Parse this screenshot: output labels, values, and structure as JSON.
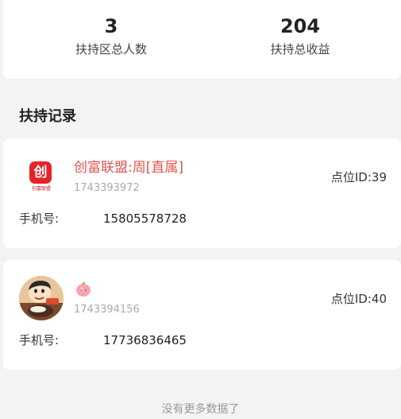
{
  "stats": {
    "total_people_value": "3",
    "total_people_label": "扶持区总人数",
    "total_income_value": "204",
    "total_income_label": "扶持总收益"
  },
  "section": {
    "title": "扶持记录"
  },
  "records": [
    {
      "name": "创富联盟:周[直属]",
      "uid": "1743393972",
      "slot_label": "点位ID:",
      "slot_value": "39",
      "phone_label": "手机号:",
      "phone": "15805578728",
      "avatar_logo_char": "创",
      "avatar_logo_text": "创富联盟",
      "avatar_icon": "brand-logo-icon",
      "name_color": "#e0554d"
    },
    {
      "name": "",
      "name_icon": "peach-emoji-icon",
      "uid": "1743394156",
      "slot_label": "点位ID:",
      "slot_value": "40",
      "phone_label": "手机号:",
      "phone": "17736836465",
      "avatar_icon": "cartoon-avatar-icon"
    }
  ],
  "footer": {
    "text": "没有更多数据了"
  },
  "colors": {
    "page_bg": "#f3f3f3",
    "card_bg": "#ffffff",
    "accent_red": "#e8222a",
    "muted_text": "#999999"
  }
}
